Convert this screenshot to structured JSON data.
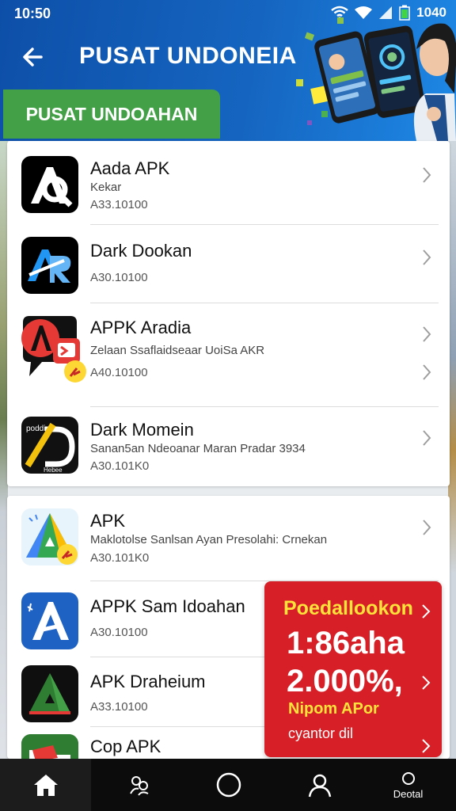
{
  "status_bar": {
    "time": "10:50",
    "battery": "1040"
  },
  "header": {
    "title": "PUSAT UNDONEIA",
    "banner_label": "PUSAT UNDOAHAN"
  },
  "apps": [
    {
      "name": "Aada APK",
      "subtitle": "Kekar",
      "size": "A33.10100",
      "icon": "aa-logo-icon"
    },
    {
      "name": "Dark Dookan",
      "subtitle": "",
      "size": "A30.10100",
      "icon": "ar-logo-icon"
    },
    {
      "name": "APPK Aradia",
      "subtitle": "Zelaan Ssaflaidseaar UoiSa AKR",
      "size": "A40.10100",
      "icon": "a-chat-logo-icon"
    },
    {
      "name": "Dark Momein",
      "subtitle": "Sanan5an Ndeoanar Maran Pradar 3934",
      "size": "A30.101K0",
      "icon": "d-slash-logo-icon"
    },
    {
      "name": "APK",
      "subtitle": "Maklotolse Sanlsan Ayan Presolahi: Crnekan",
      "size": "A30.101K0",
      "icon": "map-triangle-logo-icon"
    },
    {
      "name": "APPK Sam Idoahan",
      "subtitle": "",
      "size": "A30.10100",
      "icon": "blue-a-logo-icon"
    },
    {
      "name": "APK Draheium",
      "subtitle": "",
      "size": "A33.10100",
      "icon": "green-triangle-logo-icon"
    },
    {
      "name": "Cop APK",
      "subtitle": "",
      "size": "",
      "icon": "folder-logo-icon"
    }
  ],
  "promo": {
    "heading": "Poedallookon",
    "line1": "1:86aha",
    "line2": "2.000%,",
    "line3": "Nipom APor",
    "line4": "cyantor dil"
  },
  "bottom_nav": {
    "last_label": "Deotal"
  },
  "colors": {
    "header_blue": "#1565c0",
    "banner_green": "#43a047",
    "promo_red": "#d61f26",
    "promo_yellow": "#ffe23a"
  }
}
